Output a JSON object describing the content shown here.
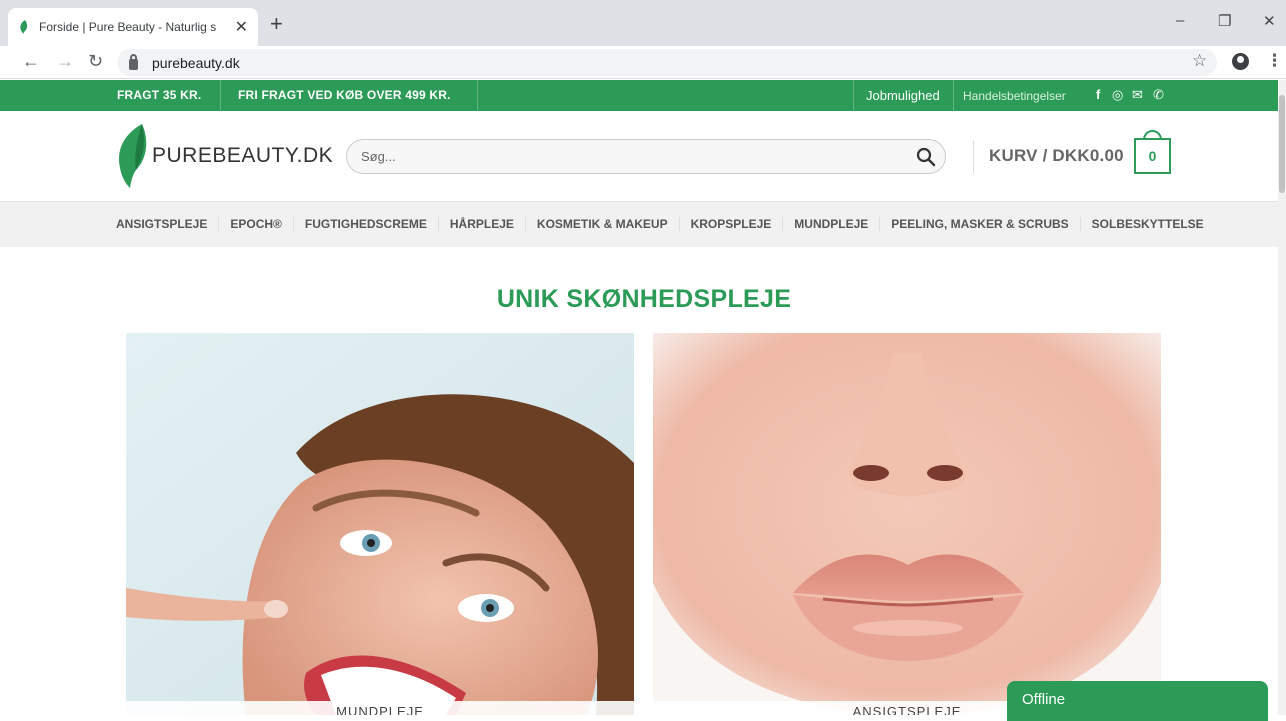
{
  "browser": {
    "tab_title": "Forside | Pure Beauty - Naturlig s",
    "url": "purebeauty.dk",
    "icons": [
      "leaf-favicon",
      "close-icon",
      "plus-icon",
      "minimize-icon",
      "restore-icon",
      "window-close-icon",
      "back-icon",
      "forward-icon",
      "reload-icon",
      "lock-icon",
      "star-icon",
      "profile-icon",
      "menu-icon"
    ]
  },
  "topbar": {
    "promo_left": "FRAGT 35 KR.",
    "promo_right": "FRI FRAGT VED KØB OVER 499 KR.",
    "link_jobs": "Jobmulighed",
    "link_terms": "Handelsbetingelser",
    "color": "#2b9b57"
  },
  "header": {
    "logo_text": "PUREBEAUTY.DK",
    "search_placeholder": "Søg...",
    "cart_label": "KURV / DKK0.00",
    "cart_count": "0"
  },
  "nav": {
    "items": [
      {
        "label": "ANSIGTSPLEJE"
      },
      {
        "label": "EPOCH®"
      },
      {
        "label": "FUGTIGHEDSCREME"
      },
      {
        "label": "HÅRPLEJE"
      },
      {
        "label": "KOSMETIK & MAKEUP"
      },
      {
        "label": "KROPSPLEJE"
      },
      {
        "label": "MUNDPLEJE"
      },
      {
        "label": "PEELING, MASKER & SCRUBS"
      },
      {
        "label": "SOLBESKYTTELSE"
      }
    ]
  },
  "main": {
    "headline": "UNIK SKØNHEDSPLEJE",
    "cards": [
      {
        "label": "MUNDPLEJE"
      },
      {
        "label": "ANSIGTSPLEJE"
      }
    ]
  },
  "chat": {
    "status": "Offline"
  }
}
